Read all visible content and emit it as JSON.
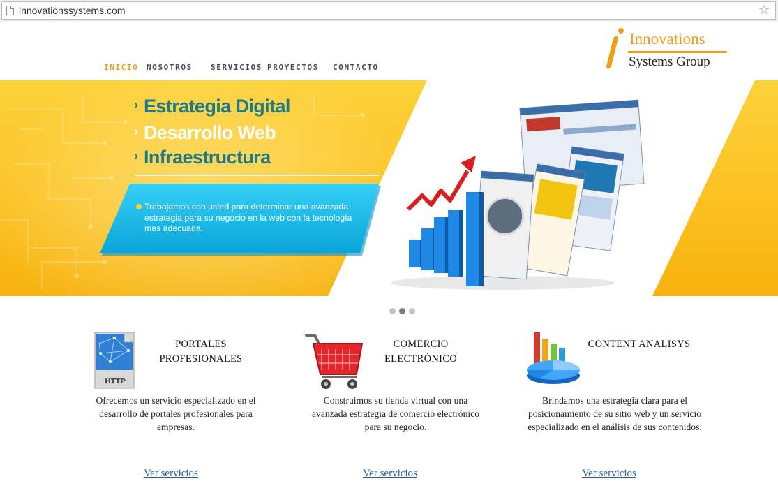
{
  "browser": {
    "url": "innovationssystems.com",
    "bookmark_icon": "star-icon"
  },
  "nav": {
    "items": [
      {
        "label": "INICIO",
        "active": true
      },
      {
        "label": "NOSOTROS",
        "active": false
      },
      {
        "label": "SERVICIOS",
        "active": false
      },
      {
        "label": "PROYECTOS",
        "active": false
      },
      {
        "label": "CONTACTO",
        "active": false
      }
    ]
  },
  "logo": {
    "line1": "Innovations",
    "line2": "Systems Group"
  },
  "hero": {
    "bullets": [
      "Estrategia Digital",
      "Desarrollo Web",
      "Infraestructura"
    ],
    "panel_text": "Trabajamos con usted para determinar una avanzada estrategia para su negocio en la web con la tecnología mas adecuada.",
    "slides": 3,
    "active_slide": 2
  },
  "features": [
    {
      "icon": "http-document-icon",
      "title_line1": "PORTALES",
      "title_line2": "PROFESIONALES",
      "description": "Ofrecemos un servicio especializado en el desarrollo de portales profesionales para empresas.",
      "link": "Ver servicios"
    },
    {
      "icon": "shopping-cart-icon",
      "title_line1": "COMERCIO",
      "title_line2": "ELECTRÓNICO",
      "description": "Construimos su tienda virtual con una avanzada estrategia de comercio electrónico para su negocio.",
      "link": "Ver servicios"
    },
    {
      "icon": "chart-analytics-icon",
      "title_line1": "CONTENT ANALISYS",
      "title_line2": "",
      "description": "Brindamos una estrategia clara para el posicionamiento de su sitio web y un servicio especializado en el análisis de sus contenidos.",
      "link": "Ver servicios"
    }
  ],
  "colors": {
    "accent_orange": "#f0a018",
    "hero_yellow": "#fbc121",
    "panel_cyan": "#19b9e6",
    "link_blue": "#2a5d9a"
  }
}
